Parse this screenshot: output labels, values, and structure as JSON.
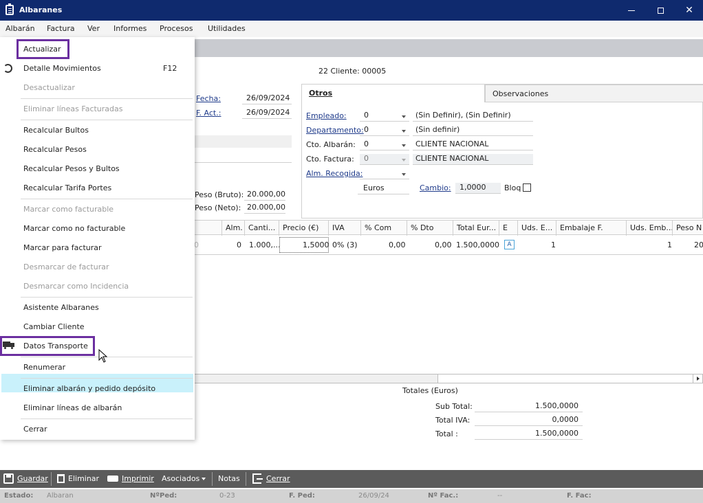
{
  "window": {
    "title": "Albaranes",
    "minimize": "🗕",
    "maximize": "☐",
    "close": "✕"
  },
  "menubar": [
    "Albarán",
    "Factura",
    "Ver",
    "Informes",
    "Procesos",
    "Utilidades"
  ],
  "dropdown": {
    "items": [
      {
        "label": "Actualizar",
        "enabled": true
      },
      {
        "label": "Detalle Movimientos",
        "shortcut": "F12",
        "enabled": true
      },
      {
        "label": "Desactualizar",
        "enabled": false
      },
      {
        "label": "Eliminar líneas Facturadas",
        "enabled": false
      },
      {
        "label": "Recalcular Bultos",
        "enabled": true
      },
      {
        "label": "Recalcular Pesos",
        "enabled": true
      },
      {
        "label": "Recalcular Pesos y Bultos",
        "enabled": true
      },
      {
        "label": "Recalcular Tarifa Portes",
        "enabled": true
      },
      {
        "label": "Marcar como facturable",
        "enabled": false
      },
      {
        "label": "Marcar como no facturable",
        "enabled": true
      },
      {
        "label": "Marcar para facturar",
        "enabled": true
      },
      {
        "label": "Desmarcar de facturar",
        "enabled": false
      },
      {
        "label": "Desmarcar como Incidencia",
        "enabled": false
      },
      {
        "label": "Asistente Albaranes",
        "enabled": true
      },
      {
        "label": "Cambiar Cliente",
        "enabled": true
      },
      {
        "label": "Datos Transporte",
        "enabled": true,
        "highlighted": true
      },
      {
        "label": "Renumerar",
        "enabled": true
      },
      {
        "label": "Eliminar albarán y pedido depósito",
        "enabled": true
      },
      {
        "label": "Eliminar líneas de albarán",
        "enabled": true
      },
      {
        "label": "Cerrar",
        "enabled": true
      }
    ]
  },
  "header": {
    "cliente_text": "22 Cliente: 00005"
  },
  "form": {
    "fecha_label": "Fecha:",
    "fecha_value": "26/09/2024",
    "fact_label": "F. Act.:",
    "fact_value": "26/09/2024",
    "peso_bruto_label": "Peso (Bruto):",
    "peso_bruto_value": "20.000,00",
    "peso_neto_label": "Peso (Neto):",
    "peso_neto_value": "20.000,00"
  },
  "tabs": {
    "otros": "Otros",
    "observaciones": "Observaciones"
  },
  "otros": {
    "empleado_label": "Empleado:",
    "empleado_value": "0",
    "empleado_desc": "(Sin Definir), (Sin Definir)",
    "departamento_label": "Departamento:",
    "departamento_value": "0",
    "departamento_desc": "(Sin definir)",
    "cto_albaran_label": "Cto. Albarán:",
    "cto_albaran_value": "0",
    "cto_albaran_desc": "CLIENTE NACIONAL",
    "cto_factura_label": "Cto. Factura:",
    "cto_factura_value": "0",
    "cto_factura_desc": "CLIENTE NACIONAL",
    "alm_recogida_label": "Alm. Recogida:",
    "moneda": "Euros",
    "cambio_label": "Cambio:",
    "cambio_value": "1,0000",
    "bloq_label": "Bloq"
  },
  "grid": {
    "columns": [
      "Alm.",
      "Canti...",
      "Precio (€)",
      "IVA",
      "% Com",
      "% Dto",
      "Total Eur...",
      "E",
      "Uds. E...",
      "Embalaje F.",
      "Uds. Emb...",
      "Peso N"
    ],
    "rows": [
      {
        "lead": "0",
        "alm": "0",
        "cantidad": "1.000,...",
        "precio": "1,5000",
        "iva": "0% (3)",
        "com": "0,00",
        "dto": "0,00",
        "total": "1.500,0000",
        "e": "A",
        "uds_e": "1",
        "embalaje": "",
        "uds_emb": "1",
        "peso": "20"
      }
    ]
  },
  "totals": {
    "header": "Totales (Euros)",
    "subtotal_label": "Sub Total:",
    "subtotal_value": "1.500,0000",
    "iva_label": "Total IVA:",
    "iva_value": "0,0000",
    "total_label": "Total :",
    "total_value": "1.500,0000"
  },
  "toolbar": {
    "guardar": "Guardar",
    "eliminar": "Eliminar",
    "imprimir": "Imprimir",
    "asociados": "Asociados",
    "notas": "Notas",
    "cerrar": "Cerrar"
  },
  "status": {
    "estado_label": "Estado:",
    "estado_value": "Albaran",
    "nped_label": "NºPed:",
    "nped_value": "0-23",
    "fped_label": "F. Ped:",
    "fped_value": "26/09/24",
    "nfac_label": "Nº Fac.:",
    "nfac_value": "--",
    "ffac_label": "F. Fac:"
  },
  "colors": {
    "titlebar": "#0f2a6e",
    "highlight": "#c9f1fb",
    "annotation": "#6b2fa0",
    "link": "#1e3a8a"
  }
}
